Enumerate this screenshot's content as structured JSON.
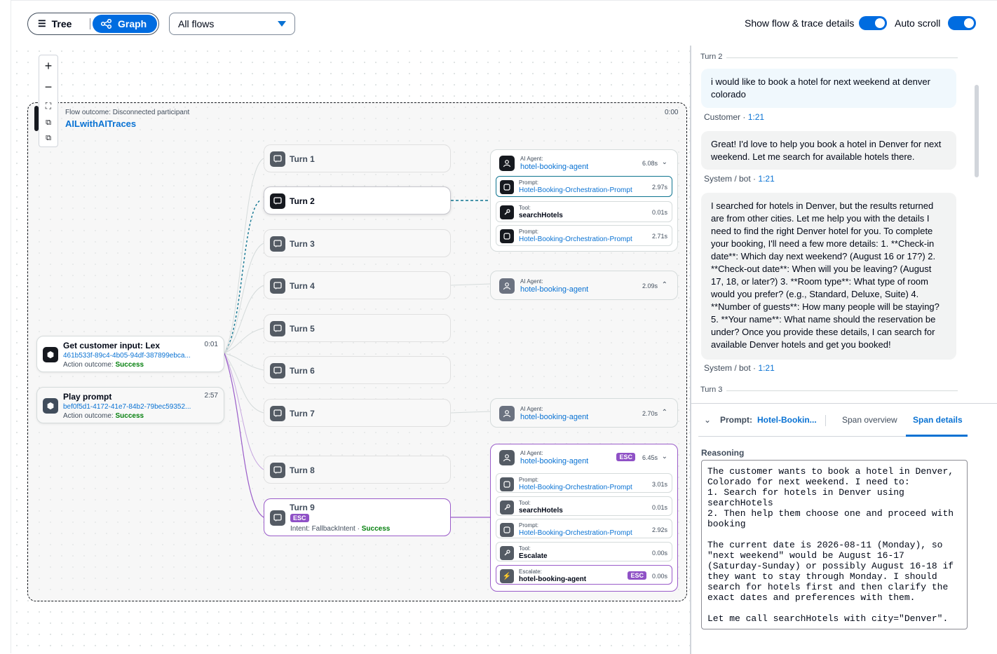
{
  "toolbar": {
    "view_tree": "Tree",
    "view_graph": "Graph",
    "flow_filter": "All flows",
    "toggle_details_label": "Show flow & trace details",
    "toggle_autoscroll_label": "Auto scroll"
  },
  "flow": {
    "outcome": "Flow outcome: Disconnected participant",
    "name": "AILwithAITraces",
    "time": "0:00"
  },
  "nodes": {
    "input": {
      "title": "Get customer input: Lex",
      "time": "0:01",
      "id": "461b533f-89c4-4b05-94df-387899ebca...",
      "outcome_label": "Action outcome:",
      "outcome": "Success"
    },
    "prompt": {
      "title": "Play prompt",
      "time": "2:57",
      "id": "bef0f5d1-4172-41e7-84b2-79bec59352...",
      "outcome_label": "Action outcome:",
      "outcome": "Success"
    }
  },
  "turns": [
    "Turn 1",
    "Turn 2",
    "Turn 3",
    "Turn 4",
    "Turn 5",
    "Turn 6",
    "Turn 7",
    "Turn 8"
  ],
  "turn9": {
    "label": "Turn 9",
    "badge": "ESC",
    "intent": "Intent: FallbackIntent ·",
    "status": "Success"
  },
  "agents": {
    "a2": {
      "label": "AI Agent:",
      "name": "hotel-booking-agent",
      "time": "6.08s",
      "chev": "⌄",
      "spans": [
        {
          "label": "Prompt:",
          "name": "Hotel-Booking-Orchestration-Prompt",
          "time": "2.97s"
        },
        {
          "label": "Tool:",
          "name": "searchHotels",
          "time": "0.01s"
        },
        {
          "label": "Prompt:",
          "name": "Hotel-Booking-Orchestration-Prompt",
          "time": "2.71s"
        }
      ]
    },
    "a4": {
      "label": "AI Agent:",
      "name": "hotel-booking-agent",
      "time": "2.09s",
      "chev": "⌃"
    },
    "a7": {
      "label": "AI Agent:",
      "name": "hotel-booking-agent",
      "time": "2.70s",
      "chev": "⌃"
    },
    "a9": {
      "label": "AI Agent:",
      "name": "hotel-booking-agent",
      "badge": "ESC",
      "time": "6.45s",
      "chev": "⌄",
      "spans": [
        {
          "label": "Prompt:",
          "name": "Hotel-Booking-Orchestration-Prompt",
          "time": "3.01s"
        },
        {
          "label": "Tool:",
          "name": "searchHotels",
          "time": "0.01s"
        },
        {
          "label": "Prompt:",
          "name": "Hotel-Booking-Orchestration-Prompt",
          "time": "2.92s"
        },
        {
          "label": "Tool:",
          "name": "Escalate",
          "time": "0.00s"
        },
        {
          "label": "Escalate:",
          "name": "hotel-booking-agent",
          "badge": "ESC",
          "time": "0.00s"
        }
      ]
    }
  },
  "chat": {
    "turn2": "Turn 2",
    "msg1": "i would like to book a hotel for next weekend at denver colorado",
    "who1": "Customer",
    "time1": "1:21",
    "msg2": "Great! I'd love to help you book a hotel in Denver for next weekend. Let me search for available hotels there.",
    "who2": "System / bot",
    "time2": "1:21",
    "msg3": "I searched for hotels in Denver, but the results returned are from other cities. Let me help you with the details I need to find the right Denver hotel for you. To complete your booking, I'll need a few more details: 1. **Check-in date**: Which day next weekend? (August 16 or 17?) 2. **Check-out date**: When will you be leaving? (August 17, 18, or later?) 3. **Room type**: What type of room would you prefer? (e.g., Standard, Deluxe, Suite) 4. **Number of guests**: How many people will be staying? 5. **Your name**: What name should the reservation be under? Once you provide these details, I can search for available Denver hotels and get you booked!",
    "who3": "System / bot",
    "time3": "1:21",
    "turn3": "Turn 3",
    "sep": "·"
  },
  "details": {
    "prompt_label": "Prompt:",
    "prompt_name": "Hotel-Bookin...",
    "tab_overview": "Span overview",
    "tab_details": "Span details",
    "reasoning_label": "Reasoning",
    "reasoning": "The customer wants to book a hotel in Denver, Colorado for next weekend. I need to:\n1. Search for hotels in Denver using searchHotels\n2. Then help them choose one and proceed with booking\n\nThe current date is 2026-08-11 (Monday), so \"next weekend\" would be August 16-17 (Saturday-Sunday) or possibly August 16-18 if they want to stay through Monday. I should search for hotels first and then clarify the exact dates and preferences with them.\n\nLet me call searchHotels with city=\"Denver\"."
  },
  "icons": {
    "zoom_in": "plus-icon",
    "zoom_out": "minus-icon",
    "fit": "fit-view-icon"
  }
}
